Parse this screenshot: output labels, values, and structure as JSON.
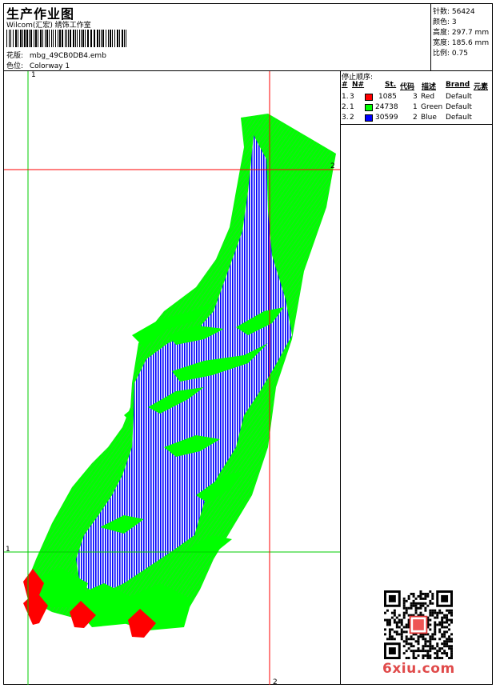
{
  "header": {
    "title": "生产作业图",
    "company": "Wilcom(汇宏) 绣饰工作室",
    "design_label": "花版:",
    "design_value": "mbg_49CB0DB4.emb",
    "colorway_label": "色位:",
    "colorway_value": "Colorway 1"
  },
  "stats": [
    {
      "label": "针数:",
      "value": "56424"
    },
    {
      "label": "颜色:",
      "value": "3"
    },
    {
      "label": "高度:",
      "value": "297.7 mm"
    },
    {
      "label": "宽度:",
      "value": "185.6 mm"
    },
    {
      "label": "比例:",
      "value": "0.75"
    }
  ],
  "legend": {
    "title": "停止顺序:",
    "headers": {
      "hash": "#",
      "n": "N#",
      "st": "St.",
      "code": "代码",
      "desc": "描述",
      "brand": "Brand",
      "elem": "元素"
    },
    "rows": [
      {
        "idx": "1.",
        "n": "3",
        "color": "#ff0000",
        "st": "1085",
        "code": "3",
        "desc": "Red",
        "brand": "Default"
      },
      {
        "idx": "2.",
        "n": "1",
        "color": "#00ff00",
        "st": "24738",
        "code": "1",
        "desc": "Green",
        "brand": "Default"
      },
      {
        "idx": "3.",
        "n": "2",
        "color": "#0000ff",
        "st": "30599",
        "code": "2",
        "desc": "Blue",
        "brand": "Default"
      }
    ]
  },
  "guides": {
    "top_left": "1",
    "right_upper": "2",
    "left_lower": "1",
    "bottom": "2"
  },
  "watermark": "6xiu.com",
  "colors": {
    "red": "#ff0000",
    "green": "#00ff00",
    "blue": "#0000ff",
    "guide_green": "#00cc00",
    "guide_red": "#ff0000",
    "watermark": "#e04a4a"
  }
}
